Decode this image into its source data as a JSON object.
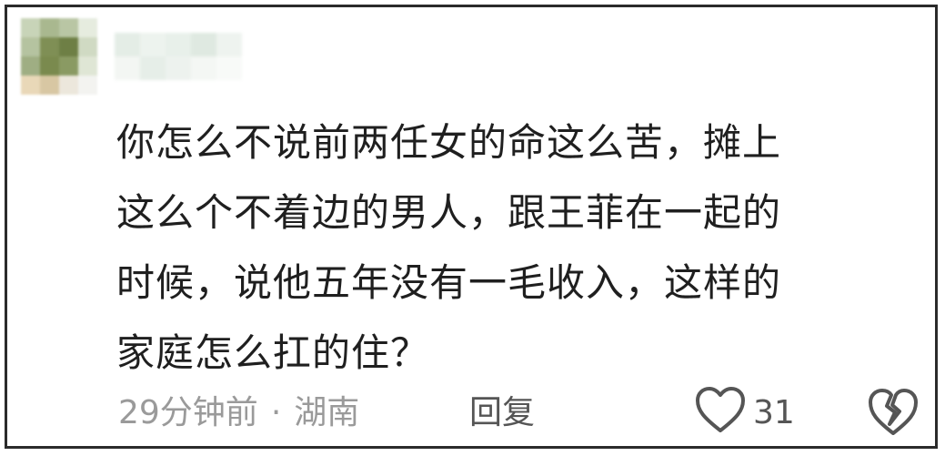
{
  "comment": {
    "lines": [
      "你怎么不说前两任女的命这么苦，摊上",
      "这么个不着边的男人，跟王菲在一起的",
      "时候，说他五年没有一毛收入，这样的",
      "家庭怎么扛的住？"
    ]
  },
  "meta": {
    "time": "29分钟前",
    "separator": "·",
    "location": "湖南"
  },
  "actions": {
    "reply_label": "回复",
    "like_count": "31",
    "like_icon": "heart-outline-icon",
    "dislike_icon": "broken-heart-icon"
  },
  "colors": {
    "text": "#1f1f1f",
    "meta": "#9a9a9a",
    "action": "#555555",
    "border": "#2b2b2b"
  }
}
